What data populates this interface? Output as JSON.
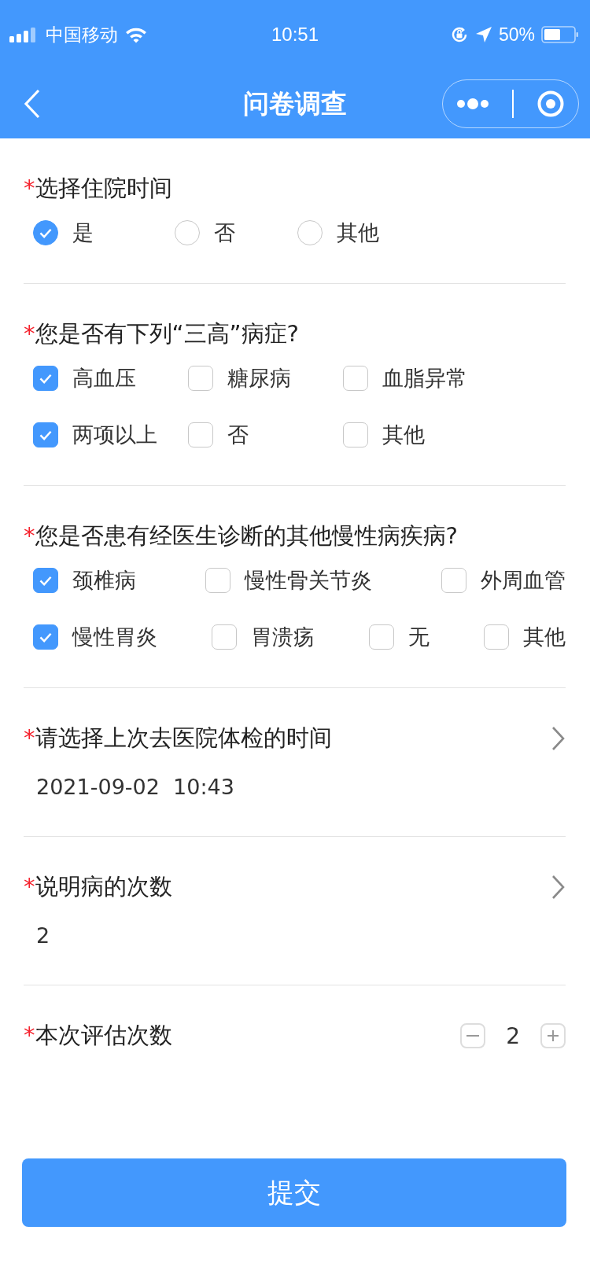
{
  "status_bar": {
    "carrier": "中国移动",
    "time": "10:51",
    "battery_text": "50%"
  },
  "nav": {
    "title": "问卷调查"
  },
  "questions": [
    {
      "kind": "radio",
      "mark": "*",
      "title": "选择住院时间",
      "rows": [
        {
          "options": [
            {
              "label": "是",
              "selected": true
            },
            {
              "label": "否",
              "selected": false
            },
            {
              "label": "其他",
              "selected": false
            }
          ]
        }
      ]
    },
    {
      "kind": "checkbox",
      "mark": "*",
      "title": "您是否有下列“三高”病症?",
      "rows": [
        {
          "options": [
            {
              "label": "高血压",
              "checked": true
            },
            {
              "label": "糖尿病",
              "checked": false
            },
            {
              "label": "血脂异常",
              "checked": false
            }
          ]
        },
        {
          "options": [
            {
              "label": "两项以上",
              "checked": true
            },
            {
              "label": "否",
              "checked": false
            },
            {
              "label": "其他",
              "checked": false
            }
          ]
        }
      ]
    },
    {
      "kind": "checkbox-wide",
      "mark": "*",
      "title": "您是否患有经医生诊断的其他慢性病疾病?",
      "rows": [
        {
          "options": [
            {
              "label": "颈椎病",
              "checked": true
            },
            {
              "label": "慢性骨关节炎",
              "checked": false
            },
            {
              "label": "外周血管",
              "checked": false
            }
          ]
        },
        {
          "options": [
            {
              "label": "慢性胃炎",
              "checked": true
            },
            {
              "label": "胃溃疡",
              "checked": false
            },
            {
              "label": "无",
              "checked": false
            },
            {
              "label": "其他",
              "checked": false
            }
          ]
        }
      ]
    },
    {
      "kind": "picker",
      "mark": "*",
      "title": "请选择上次去医院体检的时间",
      "value": "2021-09-02  10:43"
    },
    {
      "kind": "picker",
      "mark": "*",
      "title": "说明病的次数",
      "value": "2"
    },
    {
      "kind": "stepper",
      "mark": "*",
      "title": "本次评估次数",
      "value": "2"
    }
  ],
  "submit": {
    "label": "提交"
  }
}
